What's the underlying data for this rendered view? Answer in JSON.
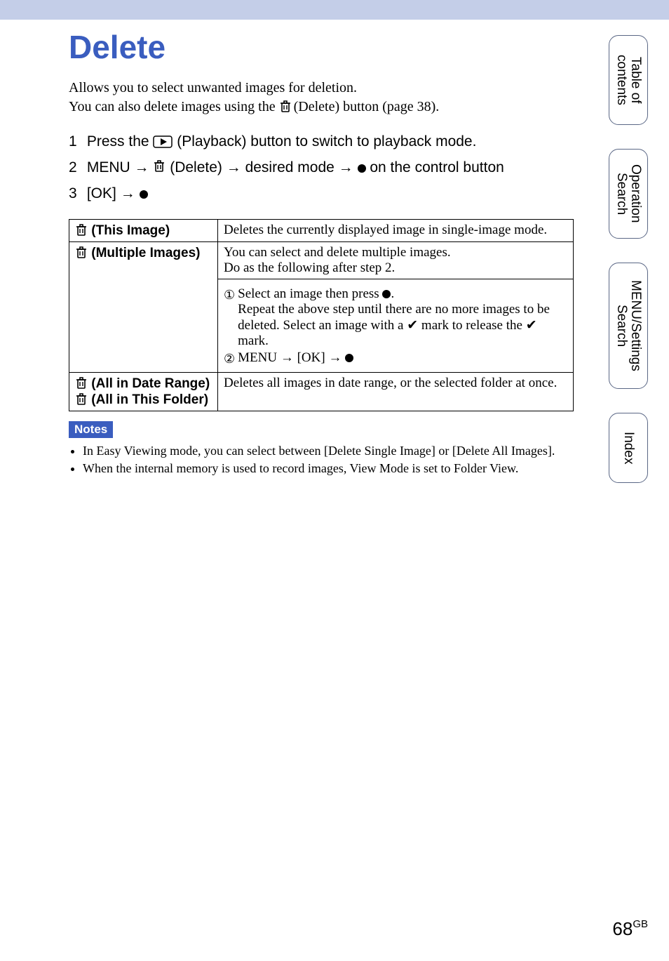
{
  "title": "Delete",
  "intro": {
    "line1": "Allows you to select unwantedted images for deletion.",
    "line1_actual": "Allows you to select unwanted images for deletion.",
    "line2_pre": "You can also delete images using the ",
    "line2_post": " (Delete) button (page 38)."
  },
  "steps": {
    "s1_pre": "Press the ",
    "s1_post": " (Playback) button to switch to playback mode.",
    "s2_pre": "MENU ",
    "s2_mid1": " (Delete) ",
    "s2_mid2": " desired mode ",
    "s2_post": " on the control button",
    "s3_pre": "[OK] "
  },
  "table": {
    "row1": {
      "label": "(This Image)",
      "desc": "Deletes the currently displayed image in single-image mode."
    },
    "row2": {
      "label": "(Multiple Images)",
      "desc_top1": "You can select and delete multiple images.",
      "desc_top2": "Do as the following after step 2.",
      "sub1_a": "Select an image then press ",
      "sub1_b": ".",
      "sub1_c": "Repeat the above step until there are no more images to be deleted. Select an image with a ",
      "sub1_d": " mark to release the ",
      "sub1_e": " mark.",
      "sub2_a": "MENU ",
      "sub2_b": " [OK] "
    },
    "row3": {
      "label_a": "(All in Date Range)",
      "label_b": "(All in This Folder)",
      "desc": "Deletes all images in date range, or the selected folder at once."
    }
  },
  "notes_badge": "Notes",
  "notes": {
    "n1": "In Easy Viewing mode, you can select between [Delete Single Image] or [Delete All Images].",
    "n2": "When the internal memory is used to record images, View Mode is set to Folder View."
  },
  "tabs": {
    "t1": "Table of\ncontents",
    "t2": "Operation\nSearch",
    "t3": "MENU/Settings\nSearch",
    "t4": "Index"
  },
  "page_number": "68",
  "page_suffix": "GB"
}
